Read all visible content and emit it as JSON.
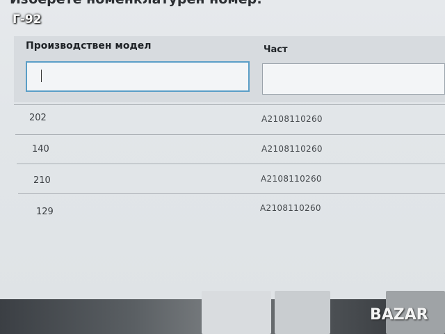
{
  "page": {
    "title": "Изберете номенклатурен номер:",
    "watermark": "Г-92"
  },
  "filters": {
    "model_label": "Производствен модел",
    "part_label": "Част",
    "model_value": "",
    "part_value": ""
  },
  "table": {
    "rows": [
      {
        "model": "202",
        "part": "A2108110260"
      },
      {
        "model": "140",
        "part": "A2108110260"
      },
      {
        "model": "210",
        "part": "A2108110260"
      },
      {
        "model": "129",
        "part": "A2108110260"
      }
    ]
  },
  "footer": {
    "logo": "BAZAR"
  }
}
